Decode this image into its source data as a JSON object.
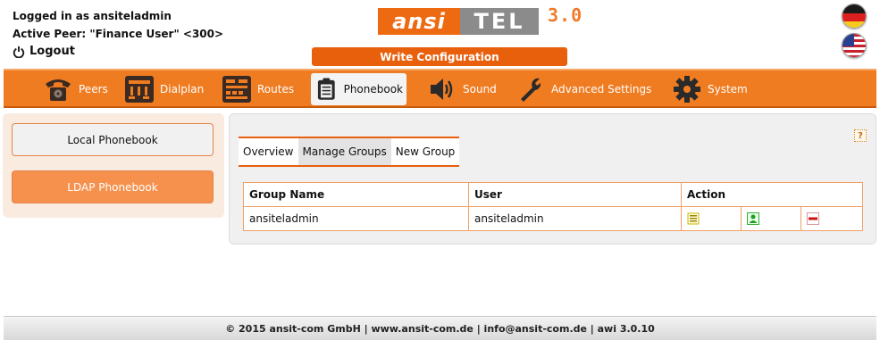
{
  "header": {
    "logged_in": "Logged in as ansiteladmin",
    "active_peer": "Active Peer: \"Finance User\" <300>",
    "logout": "Logout",
    "write_config": "Write Configuration",
    "logo": {
      "part1": "ansi",
      "part2": "TEL",
      "version": "3.0"
    }
  },
  "languages": [
    {
      "name": "German",
      "icon": "german-flag-icon"
    },
    {
      "name": "English",
      "icon": "us-flag-icon"
    }
  ],
  "nav": {
    "items": [
      {
        "label": "Peers",
        "icon": "telephone-icon"
      },
      {
        "label": "Dialplan",
        "icon": "dialplan-icon"
      },
      {
        "label": "Routes",
        "icon": "routes-icon"
      },
      {
        "label": "Phonebook",
        "icon": "phonebook-icon",
        "active": true
      },
      {
        "label": "Sound",
        "icon": "speaker-icon"
      },
      {
        "label": "Advanced Settings",
        "icon": "wrench-icon"
      },
      {
        "label": "System",
        "icon": "gear-icon"
      }
    ]
  },
  "sidebar": {
    "local": "Local Phonebook",
    "ldap": "LDAP Phonebook"
  },
  "tabs": [
    {
      "label": "Overview"
    },
    {
      "label": "Manage Groups",
      "active": true
    },
    {
      "label": "New Group"
    }
  ],
  "table": {
    "headers": [
      "Group Name",
      "User",
      "Action"
    ],
    "rows": [
      {
        "group": "ansiteladmin",
        "user": "ansiteladmin",
        "actions": [
          "list-icon",
          "add-user-icon",
          "delete-icon"
        ]
      }
    ]
  },
  "help": "?",
  "footer": "© 2015 ansit-com GmbH | www.ansit-com.de | info@ansit-com.de | awi 3.0.10",
  "colors": {
    "accent": "#f07c22",
    "button": "#e85f0c",
    "ldap": "#f5914c"
  }
}
